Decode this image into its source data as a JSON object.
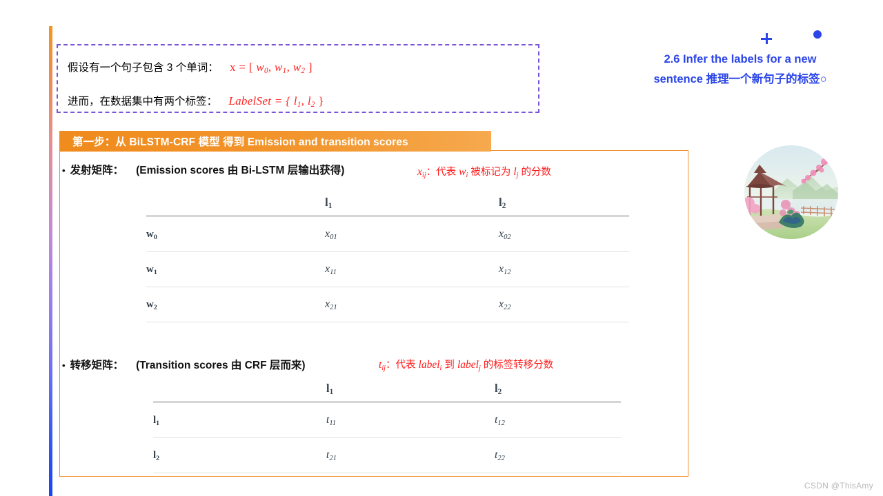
{
  "slide": {
    "heading": {
      "line1": "2.6 Infer the labels for a new",
      "line2": "sentence 推理一个新句子的标签○",
      "color": "#2b45e8"
    },
    "premise": {
      "line1_text": "假设有一个句子包含 3 个单词：",
      "line1_math_lead": "x = [ ",
      "line1_math_w0": "w",
      "line1_math_w0_sub": "0",
      "line1_math_w1": "w",
      "line1_math_w1_sub": "1",
      "line1_math_w2": "w",
      "line1_math_w2_sub": "2",
      "line1_math_tail": " ]",
      "line2_text": "进而，在数据集中有两个标签：",
      "line2_math_lead": "LabelSet = { ",
      "line2_math_l1": "l",
      "line2_math_l1_sub": "1",
      "line2_math_l2": "l",
      "line2_math_l2_sub": "2",
      "line2_math_tail": " }",
      "border_color": "#7b55d6"
    },
    "step_header": {
      "label": "第一步：从 BiLSTM-CRF 模型 得到 Emission and transition scores",
      "background": "#f08b1d"
    },
    "emission": {
      "bullet": "•",
      "label": "发射矩阵：",
      "paren": "(Emission scores 由 Bi-LSTM 层输出获得)",
      "note_var": "x",
      "note_var_sub": "ij",
      "note_rest_1": "：代表 ",
      "note_w": "w",
      "note_w_sub": "i",
      "note_rest_2": " 被标记为 ",
      "note_l": "l",
      "note_l_sub": "j",
      "note_rest_3": " 的分数",
      "note_color": "#ff1a1a"
    },
    "transition": {
      "bullet": "•",
      "label": "转移矩阵：",
      "paren": "(Transition scores 由 CRF 层而来)",
      "note_var": "t",
      "note_var_sub": "ij",
      "note_rest_1": "：代表 ",
      "note_label_i": "label",
      "note_label_i_sub": "i",
      "note_rest_2": " 到 ",
      "note_label_j": "label",
      "note_label_j_sub": "j",
      "note_rest_3": " 的标签转移分数",
      "note_color": "#ff1a1a"
    },
    "watermark": "CSDN @ThisAmy"
  },
  "chart_data": [
    {
      "type": "table",
      "title": "Emission scores",
      "corner_header": "",
      "columns": [
        "l₁",
        "l₂"
      ],
      "column_base": [
        "l",
        "l"
      ],
      "column_sub": [
        "1",
        "2"
      ],
      "rows": [
        {
          "label_base": "w",
          "label_sub": "0",
          "label": "w₀",
          "cells": [
            {
              "base": "x",
              "sub": "01",
              "text": "x01"
            },
            {
              "base": "x",
              "sub": "02",
              "text": "x02"
            }
          ]
        },
        {
          "label_base": "w",
          "label_sub": "1",
          "label": "w₁",
          "cells": [
            {
              "base": "x",
              "sub": "11",
              "text": "x11"
            },
            {
              "base": "x",
              "sub": "12",
              "text": "x12"
            }
          ]
        },
        {
          "label_base": "w",
          "label_sub": "2",
          "label": "w₂",
          "cells": [
            {
              "base": "x",
              "sub": "21",
              "text": "x21"
            },
            {
              "base": "x",
              "sub": "22",
              "text": "x22"
            }
          ]
        }
      ]
    },
    {
      "type": "table",
      "title": "Transition scores",
      "corner_header": "",
      "columns": [
        "l₁",
        "l₂"
      ],
      "column_base": [
        "l",
        "l"
      ],
      "column_sub": [
        "1",
        "2"
      ],
      "rows": [
        {
          "label_base": "l",
          "label_sub": "1",
          "label": "l₁",
          "cells": [
            {
              "base": "t",
              "sub": "11",
              "text": "t11"
            },
            {
              "base": "t",
              "sub": "12",
              "text": "t12"
            }
          ]
        },
        {
          "label_base": "l",
          "label_sub": "2",
          "label": "l₂",
          "cells": [
            {
              "base": "t",
              "sub": "21",
              "text": "t21"
            },
            {
              "base": "t",
              "sub": "22",
              "text": "t22"
            }
          ]
        }
      ]
    }
  ],
  "decor": {
    "plus_marker": "plus-marker",
    "dot_marker": "dot-marker",
    "circle_image_alt": "chinese-pavilion-cherry-blossom-lake-illustration",
    "rail_top_color": "#f5961e",
    "rail_bottom_color": "#1744f8"
  }
}
